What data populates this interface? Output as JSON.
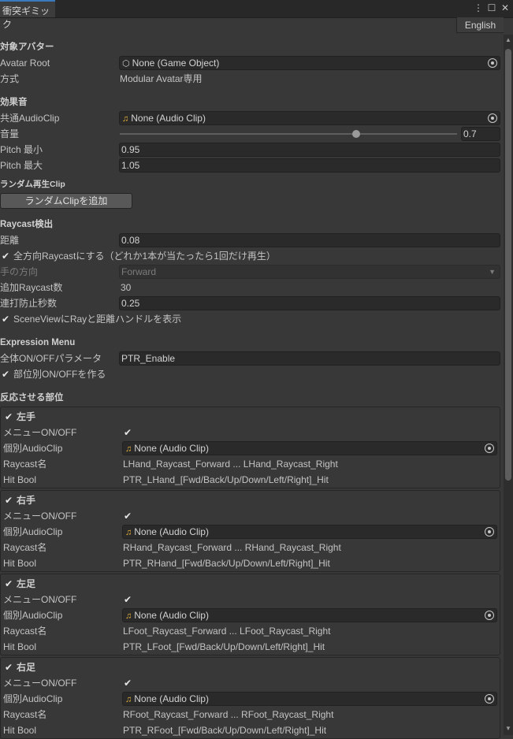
{
  "window": {
    "tab_title": "衝突ギミック",
    "lang_button": "English"
  },
  "target": {
    "header": "対象アバター",
    "avatar_root_label": "Avatar Root",
    "avatar_root_value": "None (Game Object)",
    "method_label": "方式",
    "method_value": "Modular Avatar専用"
  },
  "sound": {
    "header": "効果音",
    "common_clip_label": "共通AudioClip",
    "common_clip_value": "None (Audio Clip)",
    "volume_label": "音量",
    "volume_value": "0.7",
    "volume_fraction": 0.7,
    "pitch_min_label": "Pitch 最小",
    "pitch_min_value": "0.95",
    "pitch_max_label": "Pitch 最大",
    "pitch_max_value": "1.05",
    "random_header": "ランダム再生Clip",
    "add_random_button": "ランダムClipを追加"
  },
  "raycast": {
    "header": "Raycast検出",
    "distance_label": "距離",
    "distance_value": "0.08",
    "all_dir_checkbox": "全方向Raycastにする（どれか1本が当たったら1回だけ再生）",
    "hand_dir_label": "手の方向",
    "hand_dir_value": "Forward",
    "extra_count_label": "追加Raycast数",
    "extra_count_value": "30",
    "debounce_label": "連打防止秒数",
    "debounce_value": "0.25",
    "show_handles_checkbox": "SceneViewにRayと距離ハンドルを表示"
  },
  "expression": {
    "header": "Expression Menu",
    "param_label": "全体ON/OFFパラメータ",
    "param_value": "PTR_Enable",
    "per_part_checkbox": "部位別ON/OFFを作る"
  },
  "parts": {
    "header": "反応させる部位",
    "menu_label": "メニューON/OFF",
    "clip_label": "個別AudioClip",
    "raycast_label": "Raycast名",
    "hitbool_label": "Hit Bool",
    "clip_value": "None (Audio Clip)",
    "items": [
      {
        "name": "左手",
        "raycast": "LHand_Raycast_Forward ... LHand_Raycast_Right",
        "hitbool": "PTR_LHand_[Fwd/Back/Up/Down/Left/Right]_Hit"
      },
      {
        "name": "右手",
        "raycast": "RHand_Raycast_Forward ... RHand_Raycast_Right",
        "hitbool": "PTR_RHand_[Fwd/Back/Up/Down/Left/Right]_Hit"
      },
      {
        "name": "左足",
        "raycast": "LFoot_Raycast_Forward ... LFoot_Raycast_Right",
        "hitbool": "PTR_LFoot_[Fwd/Back/Up/Down/Left/Right]_Hit"
      },
      {
        "name": "右足",
        "raycast": "RFoot_Raycast_Forward ... RFoot_Raycast_Right",
        "hitbool": "PTR_RFoot_[Fwd/Back/Up/Down/Left/Right]_Hit"
      }
    ]
  }
}
